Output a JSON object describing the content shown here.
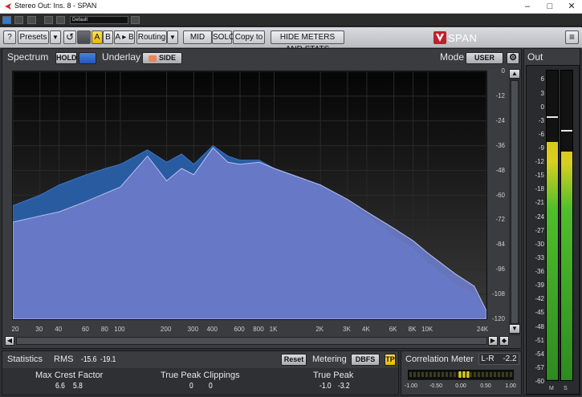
{
  "window": {
    "title": "Stereo Out: Ins. 8 - SPAN",
    "minimize": "–",
    "maximize": "□",
    "close": "✕"
  },
  "host": {
    "preset": "Default"
  },
  "toolbar": {
    "help": "?",
    "presets": "Presets",
    "dropdown": "▼",
    "undo": "↺",
    "a": "A",
    "b": "B",
    "a_to_b": "A ▸ B",
    "routing": "Routing",
    "mid": "MID",
    "solo": "SOLO",
    "copy_to": "Copy to",
    "hide_meters": "HIDE METERS AND STATS",
    "logo": "SPAN",
    "menu": "≡"
  },
  "spectrum": {
    "title": "Spectrum",
    "hold": "HOLD",
    "underlay": "Underlay",
    "side": "SIDE",
    "mode_label": "Mode",
    "mode_value": "USER",
    "colors": {
      "main": "#6b7bc9",
      "underlay": "#2a5fa8",
      "highlight": "#d8813a"
    }
  },
  "chart_data": {
    "type": "area",
    "x_scale": "log",
    "xlim": [
      20,
      24000
    ],
    "ylim": [
      -120,
      0
    ],
    "xticks": [
      "20",
      "30",
      "40",
      "60",
      "80",
      "100",
      "200",
      "300",
      "400",
      "600",
      "800",
      "1K",
      "2K",
      "3K",
      "4K",
      "6K",
      "8K",
      "10K",
      "24K"
    ],
    "xtick_values": [
      20,
      30,
      40,
      60,
      80,
      100,
      200,
      300,
      400,
      600,
      800,
      1000,
      2000,
      3000,
      4000,
      6000,
      8000,
      10000,
      24000
    ],
    "yticks": [
      "0",
      "-12",
      "-24",
      "-36",
      "-48",
      "-60",
      "-72",
      "-84",
      "-96",
      "-108",
      "-120"
    ],
    "ytick_values": [
      0,
      -12,
      -24,
      -36,
      -48,
      -60,
      -72,
      -84,
      -96,
      -108,
      -120
    ],
    "series": [
      {
        "name": "Mid",
        "x": [
          20,
          30,
          40,
          60,
          80,
          100,
          150,
          200,
          250,
          300,
          400,
          500,
          600,
          800,
          1000,
          2000,
          3000,
          4000,
          6000,
          8000,
          10000,
          15000,
          20000,
          24000
        ],
        "y": [
          -73,
          -70,
          -68,
          -63,
          -59,
          -56,
          -41,
          -53,
          -47,
          -50,
          -37,
          -44,
          -45,
          -44,
          -47,
          -55,
          -62,
          -68,
          -76,
          -82,
          -88,
          -98,
          -104,
          -116
        ]
      },
      {
        "name": "Side",
        "x": [
          20,
          30,
          40,
          60,
          80,
          100,
          150,
          200,
          250,
          300,
          400,
          500,
          600,
          800,
          1000,
          2000,
          3000,
          4000,
          6000,
          8000,
          10000,
          15000,
          20000,
          24000
        ],
        "y": [
          -65,
          -60,
          -55,
          -50,
          -47,
          -45,
          -38,
          -44,
          -40,
          -45,
          -36,
          -41,
          -43,
          -43,
          -47,
          -55,
          -63,
          -70,
          -80,
          -86,
          -93,
          -103,
          -108,
          -118
        ]
      }
    ]
  },
  "statistics": {
    "title": "Statistics",
    "rms_label": "RMS",
    "rms_l": "-15.6",
    "rms_r": "-19.1",
    "reset": "Reset",
    "metering": "Metering",
    "metering_value": "DBFS",
    "tp": "TP",
    "crest_label": "Max Crest Factor",
    "crest_l": "6.6",
    "crest_r": "5.8",
    "clip_label": "True Peak Clippings",
    "clip_l": "0",
    "clip_r": "0",
    "tp_label": "True Peak",
    "tp_l": "-1.0",
    "tp_r": "-3.2"
  },
  "correlation": {
    "title": "Correlation Meter",
    "mode": "L-R",
    "value": "-2.2",
    "scale": [
      "-1.00",
      "-0.50",
      "0.00",
      "0.50",
      "1.00"
    ],
    "level": 0.07
  },
  "out_meter": {
    "title": "Out",
    "scale": [
      "6",
      "3",
      "0",
      "-3",
      "-6",
      "-9",
      "-12",
      "-15",
      "-18",
      "-21",
      "-24",
      "-27",
      "-30",
      "-33",
      "-36",
      "-39",
      "-42",
      "-45",
      "-48",
      "-51",
      "-54",
      "-57",
      "-60"
    ],
    "left_label": "M",
    "right_label": "S",
    "left_level_db": -8,
    "right_level_db": -10,
    "left_peak_db": -2,
    "right_peak_db": -5
  }
}
